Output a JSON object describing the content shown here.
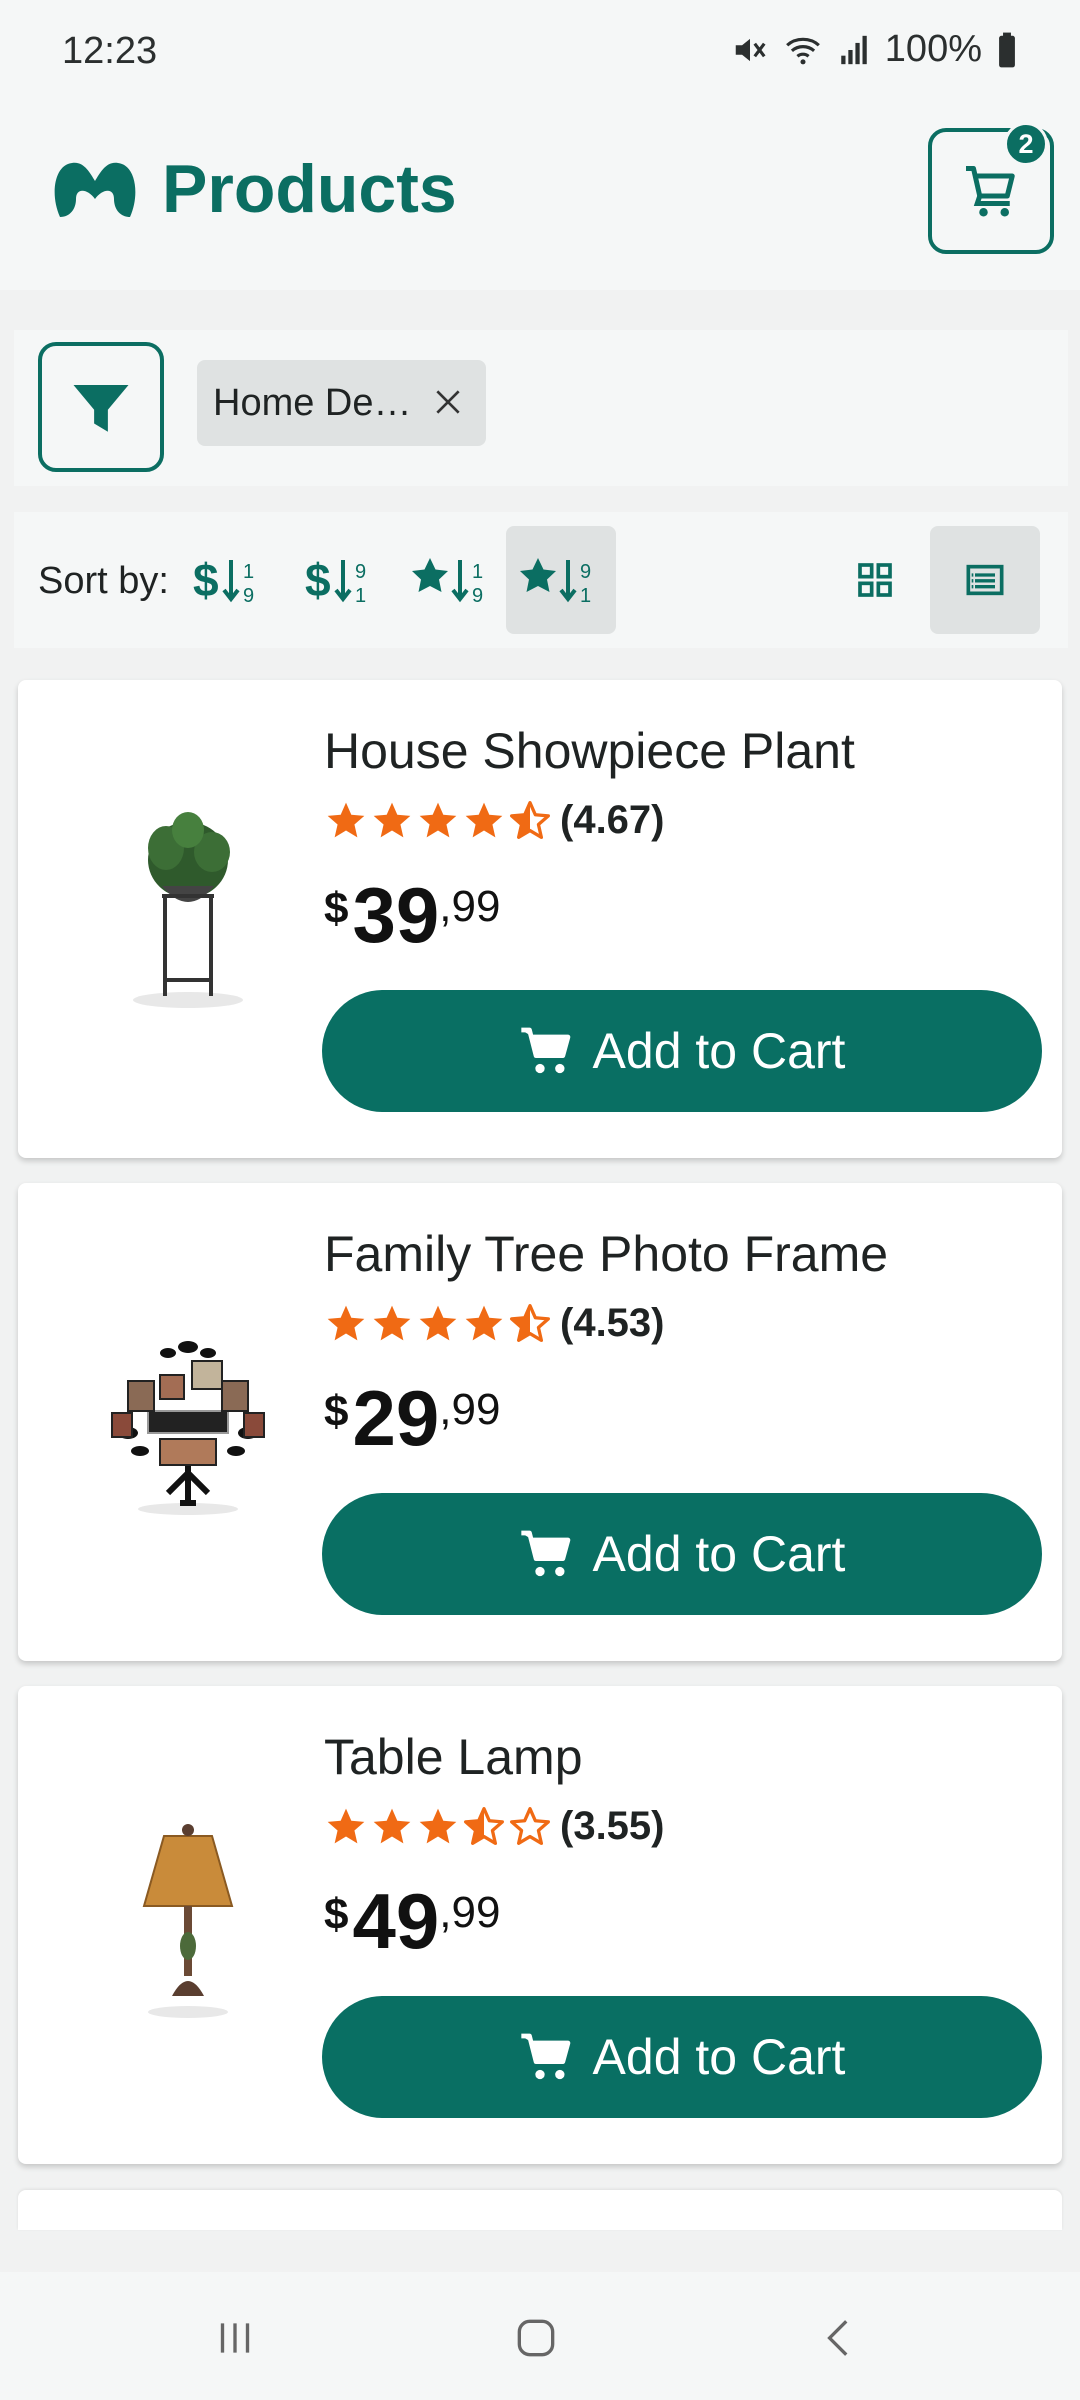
{
  "status_bar": {
    "time": "12:23",
    "battery": "100%",
    "icons": [
      "mute-icon",
      "wifi-icon",
      "signal-icon",
      "battery-icon"
    ]
  },
  "header": {
    "title": "Products",
    "logo_icon": "app-logo-icon",
    "cart_count": "2"
  },
  "filters": {
    "active_chip": "Home De…"
  },
  "sort": {
    "label": "Sort by:",
    "options": [
      {
        "name": "price-ascending",
        "active": false
      },
      {
        "name": "price-descending",
        "active": false
      },
      {
        "name": "rating-ascending",
        "active": false
      },
      {
        "name": "rating-descending",
        "active": true
      }
    ],
    "views": [
      {
        "name": "grid-view",
        "active": false
      },
      {
        "name": "list-view",
        "active": true
      }
    ]
  },
  "products": [
    {
      "name": "House Showpiece Plant",
      "rating": 4.67,
      "rating_text": "(4.67)",
      "currency": "$",
      "price_int": "39",
      "price_dec": ",99",
      "button": "Add to Cart",
      "image": "plant-icon"
    },
    {
      "name": "Family Tree Photo Frame",
      "rating": 4.53,
      "rating_text": "(4.53)",
      "currency": "$",
      "price_int": "29",
      "price_dec": ",99",
      "button": "Add to Cart",
      "image": "photo-frame-icon"
    },
    {
      "name": "Table Lamp",
      "rating": 3.55,
      "rating_text": "(3.55)",
      "currency": "$",
      "price_int": "49",
      "price_dec": ",99",
      "button": "Add to Cart",
      "image": "lamp-icon"
    }
  ],
  "colors": {
    "accent": "#0b6e62",
    "star": "#f06a14",
    "chip_bg": "#dfe2e2"
  }
}
